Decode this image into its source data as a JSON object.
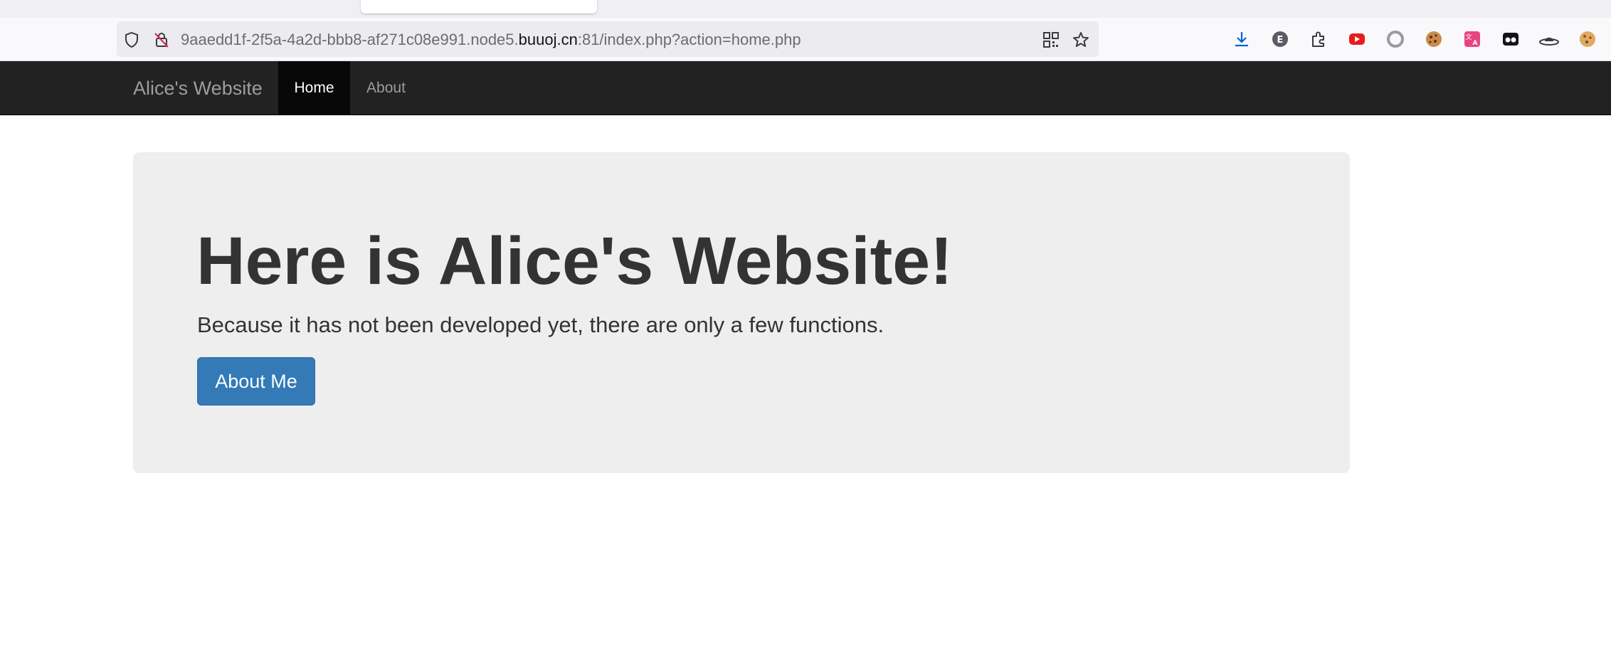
{
  "browser": {
    "url_prefix": "9aaedd1f-2f5a-4a2d-bbb8-af271c08e991.node5.",
    "url_domain": "buuoj.cn",
    "url_suffix": ":81/index.php?action=home.php"
  },
  "navbar": {
    "brand": "Alice's Website",
    "items": [
      {
        "label": "Home",
        "active": true
      },
      {
        "label": "About",
        "active": false
      }
    ]
  },
  "jumbotron": {
    "title": "Here is Alice's Website!",
    "subtitle": "Because it has not been developed yet, there are only a few functions.",
    "button_label": "About Me"
  },
  "colors": {
    "navbar_bg": "#222222",
    "active_nav_bg": "#080808",
    "jumbotron_bg": "#eeeeee",
    "primary_button": "#337ab7"
  },
  "icons": {
    "url_left": [
      "shield-icon",
      "lock-warning-icon"
    ],
    "url_right": [
      "qr-code-icon",
      "bookmark-star-icon"
    ],
    "extensions": [
      "download-icon",
      "e-extension-icon",
      "puzzle-icon",
      "youtube-icon",
      "circle-extension-icon",
      "cookie-icon",
      "translate-icon",
      "masks-icon",
      "hat-icon",
      "cookie-alt-icon"
    ]
  }
}
